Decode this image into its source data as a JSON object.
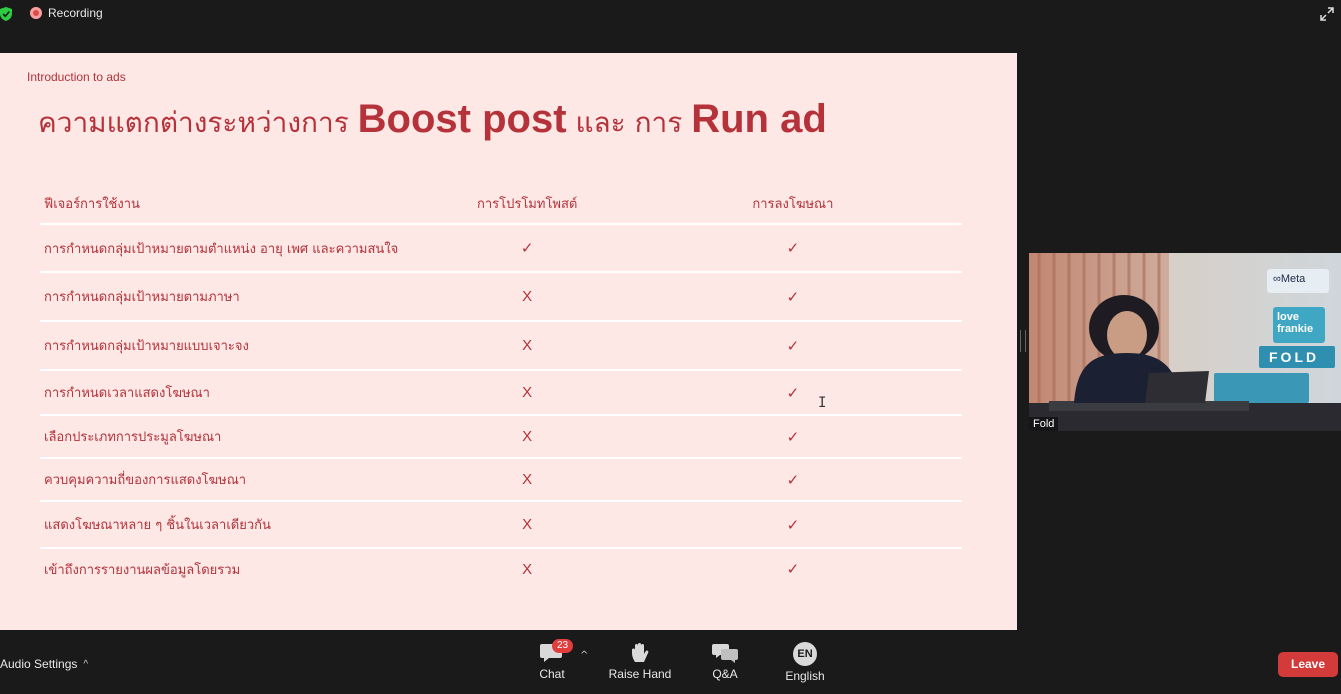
{
  "topbar": {
    "recording_label": "Recording"
  },
  "slide": {
    "subtitle": "Introduction to ads",
    "title_part1": "ความแตกต่างระหว่างการ ",
    "title_part2": "Boost post",
    "title_part3": " และ การ ",
    "title_part4": "Run ad",
    "table": {
      "headers": [
        "ฟีเจอร์การใช้งาน",
        "การโปรโมทโพสต์",
        "การลงโฆษณา"
      ],
      "rows": [
        {
          "feature": "การกำหนดกลุ่มเป้าหมายตามตำแหน่ง อายุ เพศ และความสนใจ",
          "boost": "✓",
          "run": "✓"
        },
        {
          "feature": "การกำหนดกลุ่มเป้าหมายตามภาษา",
          "boost": "X",
          "run": "✓"
        },
        {
          "feature": "การกำหนดกลุ่มเป้าหมายแบบเจาะจง",
          "boost": "X",
          "run": "✓"
        },
        {
          "feature": "การกำหนดเวลาแสดงโฆษณา",
          "boost": "X",
          "run": "✓"
        },
        {
          "feature": "เลือกประเภทการประมูลโฆษณา",
          "boost": "X",
          "run": "✓"
        },
        {
          "feature": "ควบคุมความถี่ของการแสดงโฆษณา",
          "boost": "X",
          "run": "✓"
        },
        {
          "feature": "แสดงโฆษณาหลาย ๆ ชิ้นในเวลาเดียวกัน",
          "boost": "X",
          "run": "✓"
        },
        {
          "feature": "เข้าถึงการรายงานผลข้อมูลโดยรวม",
          "boost": "X",
          "run": "✓"
        }
      ]
    }
  },
  "video": {
    "participant_name": "Fold",
    "sign_meta": "∞Meta",
    "sign_brand1": "love",
    "sign_brand2": "frankie",
    "sign_fold": "FOLD"
  },
  "bottombar": {
    "audio_settings": "Audio Settings",
    "chat_label": "Chat",
    "chat_badge": "23",
    "raise_hand_label": "Raise Hand",
    "qa_label": "Q&A",
    "language_code": "EN",
    "language_label": "English",
    "leave_label": "Leave"
  },
  "colors": {
    "slide_bg": "#fde8e6",
    "slide_accent": "#b5323a",
    "leave_button": "#d33a3a",
    "badge": "#e03d3d"
  }
}
